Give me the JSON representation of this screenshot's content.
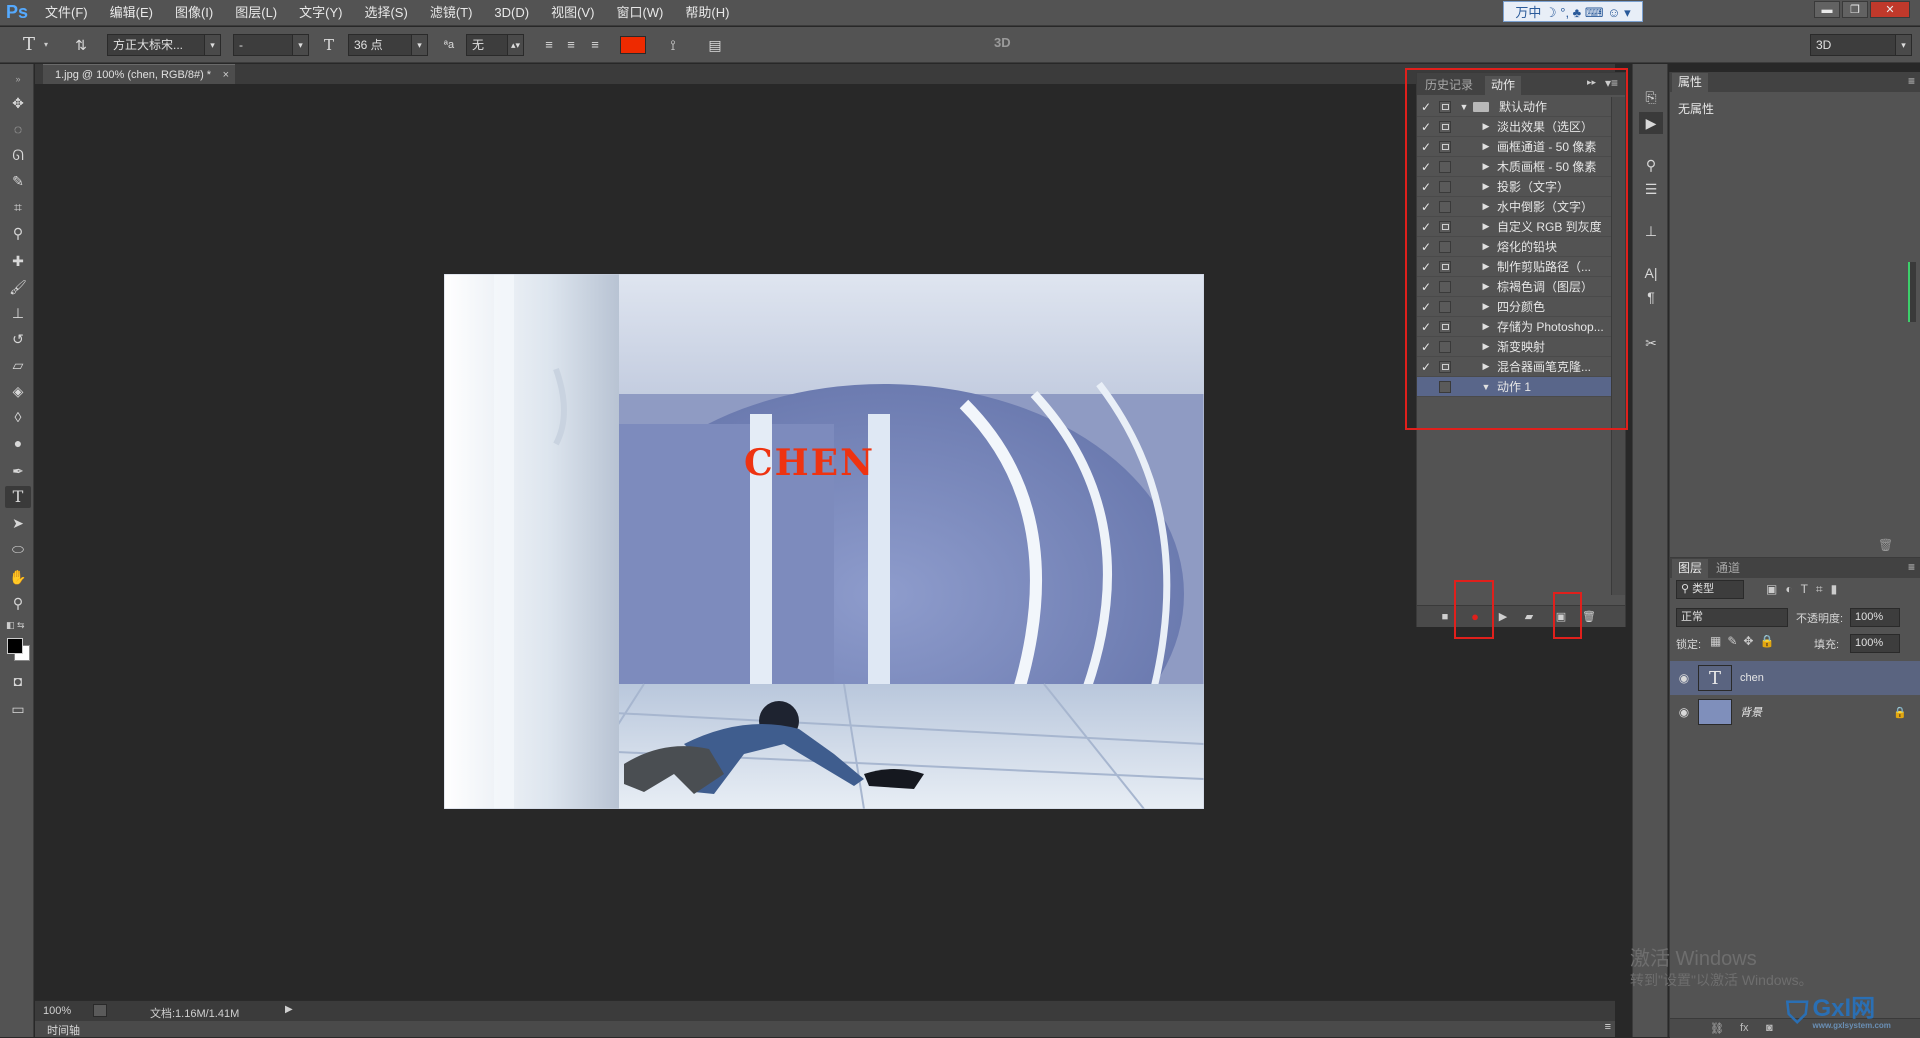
{
  "app": {
    "logo": "Ps"
  },
  "menu": [
    "文件(F)",
    "编辑(E)",
    "图像(I)",
    "图层(L)",
    "文字(Y)",
    "选择(S)",
    "滤镜(T)",
    "3D(D)",
    "视图(V)",
    "窗口(W)",
    "帮助(H)"
  ],
  "ime_bar": "万中 ☽ °, ♣ ⌨ ☺ ▾",
  "options": {
    "font_family": "方正大标宋...",
    "font_style": "-",
    "font_size": "36 点",
    "aa_label": "ªa",
    "aa_mode": "无",
    "color": "#ee2a00",
    "workspace": "3D",
    "mode_3d": "3D"
  },
  "document": {
    "tab_title": "1.jpg @ 100% (chen, RGB/8#) *",
    "overlay_text": "CHEN",
    "overlay_color": "#ee3311"
  },
  "status": {
    "zoom": "100%",
    "doc_info": "文档:1.16M/1.41M"
  },
  "timeline_label": "时间轴",
  "actions_panel": {
    "tab_history": "历史记录",
    "tab_actions": "动作",
    "items": [
      {
        "label": "默认动作",
        "checked": true,
        "dialog": true,
        "expanded": true,
        "folder": true,
        "indent": 0,
        "selected": false
      },
      {
        "label": "淡出效果（选区）",
        "checked": true,
        "dialog": true,
        "expanded": false,
        "folder": false,
        "indent": 1,
        "selected": false
      },
      {
        "label": "画框通道 - 50 像素",
        "checked": true,
        "dialog": true,
        "expanded": false,
        "folder": false,
        "indent": 1,
        "selected": false
      },
      {
        "label": "木质画框 - 50 像素",
        "checked": true,
        "dialog": false,
        "expanded": false,
        "folder": false,
        "indent": 1,
        "selected": false
      },
      {
        "label": "投影（文字）",
        "checked": true,
        "dialog": false,
        "expanded": false,
        "folder": false,
        "indent": 1,
        "selected": false
      },
      {
        "label": "水中倒影（文字）",
        "checked": true,
        "dialog": false,
        "expanded": false,
        "folder": false,
        "indent": 1,
        "selected": false
      },
      {
        "label": "自定义 RGB 到灰度",
        "checked": true,
        "dialog": true,
        "expanded": false,
        "folder": false,
        "indent": 1,
        "selected": false
      },
      {
        "label": "熔化的铅块",
        "checked": true,
        "dialog": false,
        "expanded": false,
        "folder": false,
        "indent": 1,
        "selected": false
      },
      {
        "label": "制作剪贴路径（...",
        "checked": true,
        "dialog": true,
        "expanded": false,
        "folder": false,
        "indent": 1,
        "selected": false
      },
      {
        "label": "棕褐色调（图层）",
        "checked": true,
        "dialog": false,
        "expanded": false,
        "folder": false,
        "indent": 1,
        "selected": false
      },
      {
        "label": "四分颜色",
        "checked": true,
        "dialog": false,
        "expanded": false,
        "folder": false,
        "indent": 1,
        "selected": false
      },
      {
        "label": "存储为 Photoshop...",
        "checked": true,
        "dialog": true,
        "expanded": false,
        "folder": false,
        "indent": 1,
        "selected": false
      },
      {
        "label": "渐变映射",
        "checked": true,
        "dialog": false,
        "expanded": false,
        "folder": false,
        "indent": 1,
        "selected": false
      },
      {
        "label": "混合器画笔克隆...",
        "checked": true,
        "dialog": true,
        "expanded": false,
        "folder": false,
        "indent": 1,
        "selected": false
      },
      {
        "label": "动作 1",
        "checked": false,
        "dialog": false,
        "expanded": true,
        "folder": false,
        "indent": 1,
        "selected": true
      }
    ]
  },
  "properties_panel": {
    "tab": "属性",
    "empty_text": "无属性"
  },
  "layers_panel": {
    "tab_layers": "图层",
    "tab_channels": "通道",
    "filter_kind": "类型",
    "blend_mode": "正常",
    "opacity_label": "不透明度:",
    "opacity": "100%",
    "lock_label": "锁定:",
    "fill_label": "填充:",
    "fill": "100%",
    "layers": [
      {
        "name": "chen",
        "type": "text",
        "selected": true,
        "locked": false
      },
      {
        "name": "背景",
        "type": "image",
        "selected": false,
        "locked": true
      }
    ]
  },
  "watermark": {
    "line1": "激活 Windows",
    "line2": "转到\"设置\"以激活 Windows。",
    "site": "Gxl网",
    "site_url": "www.gxlsystem.com"
  },
  "colors": {
    "annotation_red": "#e0201c",
    "panel_bg": "#535353",
    "canvas_bg": "#282828",
    "selection": "#59668a"
  }
}
